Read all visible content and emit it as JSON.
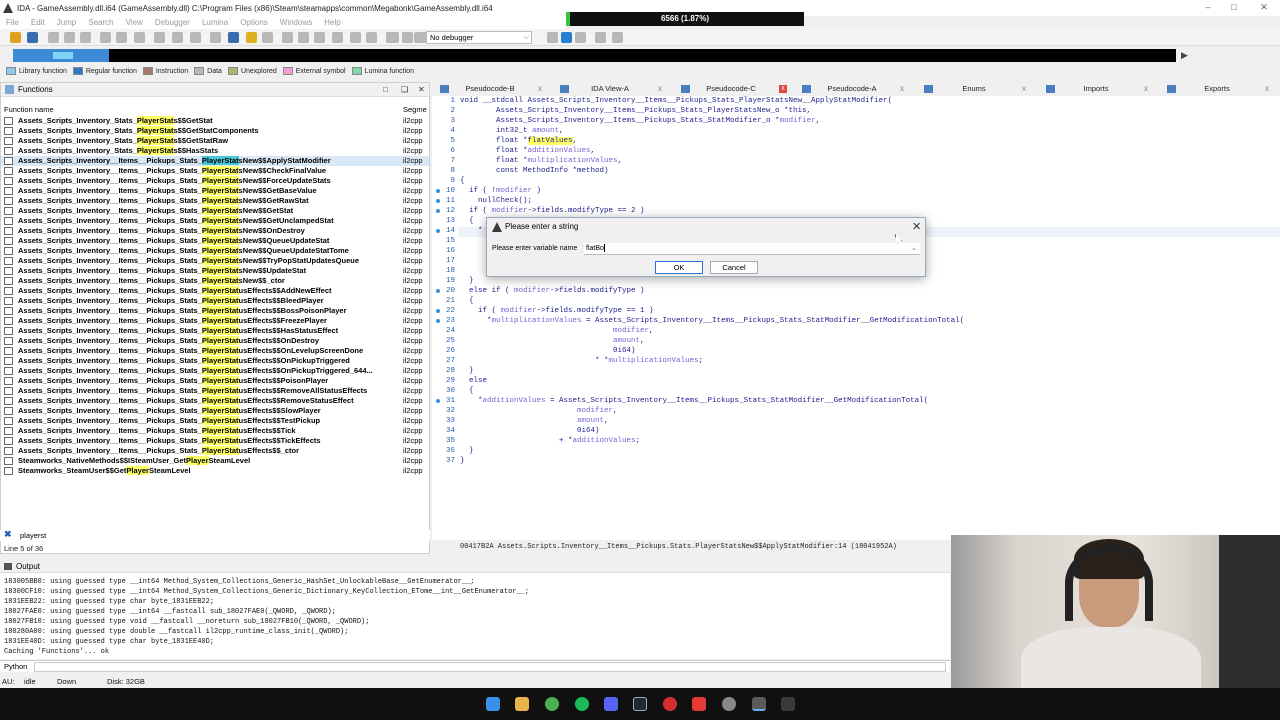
{
  "window": {
    "title": "IDA - GameAssembly.dll.i64 (GameAssembly.dll) C:\\Program Files (x86)\\Steam\\steamapps\\common\\Megabonk\\GameAssembly.dll.i64",
    "progress_label": "6566 (1.87%)",
    "progress_fraction": 0.0187
  },
  "menu": [
    "File",
    "Edit",
    "Jump",
    "Search",
    "View",
    "Debugger",
    "Lumina",
    "Options",
    "Windows",
    "Help"
  ],
  "toolbar": {
    "debugger_select": "No debugger"
  },
  "legend": [
    {
      "label": "Library function",
      "color": "#8ec8ec"
    },
    {
      "label": "Regular function",
      "color": "#2f76c5"
    },
    {
      "label": "Instruction",
      "color": "#a5786a"
    },
    {
      "label": "Data",
      "color": "#b8b8b8"
    },
    {
      "label": "Unexplored",
      "color": "#a8b86c"
    },
    {
      "label": "External symbol",
      "color": "#f59bd8"
    },
    {
      "label": "Lumina function",
      "color": "#7fd6a8"
    }
  ],
  "functions_panel": {
    "title": "Functions",
    "col_name": "Function name",
    "col_segment": "Segme",
    "rows": [
      {
        "pre": "Assets_Scripts_Inventory_Stats_",
        "hl": "PlayerStat",
        "post": "s$$GetStat",
        "seg": "il2cpp"
      },
      {
        "pre": "Assets_Scripts_Inventory_Stats_",
        "hl": "PlayerStat",
        "post": "s$$GetStatComponents",
        "seg": "il2cpp"
      },
      {
        "pre": "Assets_Scripts_Inventory_Stats_",
        "hl": "PlayerStat",
        "post": "s$$GetStatRaw",
        "seg": "il2cpp"
      },
      {
        "pre": "Assets_Scripts_Inventory_Stats_",
        "hl": "PlayerStat",
        "post": "s$$HasStats",
        "seg": "il2cpp"
      },
      {
        "pre": "Assets_Scripts_Inventory__Items__Pickups_Stats_",
        "hl": "PlayerStat",
        "post": "sNew$$ApplyStatModifier",
        "seg": "il2cpp"
      },
      {
        "pre": "Assets_Scripts_Inventory__Items__Pickups_Stats_",
        "hl": "PlayerStat",
        "post": "sNew$$CheckFinalValue",
        "seg": "il2cpp"
      },
      {
        "pre": "Assets_Scripts_Inventory__Items__Pickups_Stats_",
        "hl": "PlayerStat",
        "post": "sNew$$ForceUpdateStats",
        "seg": "il2cpp"
      },
      {
        "pre": "Assets_Scripts_Inventory__Items__Pickups_Stats_",
        "hl": "PlayerStat",
        "post": "sNew$$GetBaseValue",
        "seg": "il2cpp"
      },
      {
        "pre": "Assets_Scripts_Inventory__Items__Pickups_Stats_",
        "hl": "PlayerStat",
        "post": "sNew$$GetRawStat",
        "seg": "il2cpp"
      },
      {
        "pre": "Assets_Scripts_Inventory__Items__Pickups_Stats_",
        "hl": "PlayerStat",
        "post": "sNew$$GetStat",
        "seg": "il2cpp"
      },
      {
        "pre": "Assets_Scripts_Inventory__Items__Pickups_Stats_",
        "hl": "PlayerStat",
        "post": "sNew$$GetUnclampedStat",
        "seg": "il2cpp"
      },
      {
        "pre": "Assets_Scripts_Inventory__Items__Pickups_Stats_",
        "hl": "PlayerStat",
        "post": "sNew$$OnDestroy",
        "seg": "il2cpp"
      },
      {
        "pre": "Assets_Scripts_Inventory__Items__Pickups_Stats_",
        "hl": "PlayerStat",
        "post": "sNew$$QueueUpdateStat",
        "seg": "il2cpp"
      },
      {
        "pre": "Assets_Scripts_Inventory__Items__Pickups_Stats_",
        "hl": "PlayerStat",
        "post": "sNew$$QueueUpdateStatTome",
        "seg": "il2cpp"
      },
      {
        "pre": "Assets_Scripts_Inventory__Items__Pickups_Stats_",
        "hl": "PlayerStat",
        "post": "sNew$$TryPopStatUpdatesQueue",
        "seg": "il2cpp"
      },
      {
        "pre": "Assets_Scripts_Inventory__Items__Pickups_Stats_",
        "hl": "PlayerStat",
        "post": "sNew$$UpdateStat",
        "seg": "il2cpp"
      },
      {
        "pre": "Assets_Scripts_Inventory__Items__Pickups_Stats_",
        "hl": "PlayerStat",
        "post": "sNew$$_ctor",
        "seg": "il2cpp"
      },
      {
        "pre": "Assets_Scripts_Inventory__Items__Pickups_Stats_",
        "hl": "PlayerStat",
        "post": "usEffects$$AddNewEffect",
        "seg": "il2cpp"
      },
      {
        "pre": "Assets_Scripts_Inventory__Items__Pickups_Stats_",
        "hl": "PlayerStat",
        "post": "usEffects$$BleedPlayer",
        "seg": "il2cpp"
      },
      {
        "pre": "Assets_Scripts_Inventory__Items__Pickups_Stats_",
        "hl": "PlayerStat",
        "post": "usEffects$$BossPoisonPlayer",
        "seg": "il2cpp"
      },
      {
        "pre": "Assets_Scripts_Inventory__Items__Pickups_Stats_",
        "hl": "PlayerStat",
        "post": "usEffects$$FreezePlayer",
        "seg": "il2cpp"
      },
      {
        "pre": "Assets_Scripts_Inventory__Items__Pickups_Stats_",
        "hl": "PlayerStat",
        "post": "usEffects$$HasStatusEffect",
        "seg": "il2cpp"
      },
      {
        "pre": "Assets_Scripts_Inventory__Items__Pickups_Stats_",
        "hl": "PlayerStat",
        "post": "usEffects$$OnDestroy",
        "seg": "il2cpp"
      },
      {
        "pre": "Assets_Scripts_Inventory__Items__Pickups_Stats_",
        "hl": "PlayerStat",
        "post": "usEffects$$OnLevelupScreenDone",
        "seg": "il2cpp"
      },
      {
        "pre": "Assets_Scripts_Inventory__Items__Pickups_Stats_",
        "hl": "PlayerStat",
        "post": "usEffects$$OnPickupTriggered",
        "seg": "il2cpp"
      },
      {
        "pre": "Assets_Scripts_Inventory__Items__Pickups_Stats_",
        "hl": "PlayerStat",
        "post": "usEffects$$OnPickupTriggered_644...",
        "seg": "il2cpp"
      },
      {
        "pre": "Assets_Scripts_Inventory__Items__Pickups_Stats_",
        "hl": "PlayerStat",
        "post": "usEffects$$PoisonPlayer",
        "seg": "il2cpp"
      },
      {
        "pre": "Assets_Scripts_Inventory__Items__Pickups_Stats_",
        "hl": "PlayerStat",
        "post": "usEffects$$RemoveAllStatusEffects",
        "seg": "il2cpp"
      },
      {
        "pre": "Assets_Scripts_Inventory__Items__Pickups_Stats_",
        "hl": "PlayerStat",
        "post": "usEffects$$RemoveStatusEffect",
        "seg": "il2cpp"
      },
      {
        "pre": "Assets_Scripts_Inventory__Items__Pickups_Stats_",
        "hl": "PlayerStat",
        "post": "usEffects$$SlowPlayer",
        "seg": "il2cpp"
      },
      {
        "pre": "Assets_Scripts_Inventory__Items__Pickups_Stats_",
        "hl": "PlayerStat",
        "post": "usEffects$$TestPickup",
        "seg": "il2cpp"
      },
      {
        "pre": "Assets_Scripts_Inventory__Items__Pickups_Stats_",
        "hl": "PlayerStat",
        "post": "usEffects$$Tick",
        "seg": "il2cpp"
      },
      {
        "pre": "Assets_Scripts_Inventory__Items__Pickups_Stats_",
        "hl": "PlayerStat",
        "post": "usEffects$$TickEffects",
        "seg": "il2cpp"
      },
      {
        "pre": "Assets_Scripts_Inventory__Items__Pickups_Stats_",
        "hl": "PlayerStat",
        "post": "usEffects$$_ctor",
        "seg": "il2cpp"
      },
      {
        "pre": "Steamworks_NativeMethods$$ISteamUser_Get",
        "hl": "Player",
        "post": "SteamLevel",
        "seg": "il2cpp"
      },
      {
        "pre": "Steamworks_SteamUser$$Get",
        "hl": "Player",
        "post": "SteamLevel",
        "seg": "il2cpp"
      }
    ],
    "selected_index": 4,
    "search_query": "playerst",
    "line_status": "Line 5 of 36"
  },
  "tabs": [
    {
      "label": "Pseudocode-B",
      "close": "x"
    },
    {
      "label": "IDA View-A",
      "close": "x"
    },
    {
      "label": "Pseudocode-C",
      "close": "x",
      "active": true
    },
    {
      "label": "Pseudocode-A",
      "close": "x"
    },
    {
      "label": "Enums",
      "close": "x"
    },
    {
      "label": "Imports",
      "close": "x"
    },
    {
      "label": "Exports",
      "close": "x"
    }
  ],
  "code": {
    "lines": [
      {
        "n": "1",
        "t": "void __stdcall Assets_Scripts_Inventory__Items__Pickups_Stats_PlayerStatsNew__ApplyStatModifier("
      },
      {
        "n": "2",
        "t": "        Assets_Scripts_Inventory__Items__Pickups_Stats_PlayerStatsNew_o *this,"
      },
      {
        "n": "3",
        "t": "        Assets_Scripts_Inventory__Items__Pickups_Stats_StatModifier_o *modifier,"
      },
      {
        "n": "4",
        "t": "        int32_t amount,"
      },
      {
        "n": "5",
        "t": "        float *flatValues,"
      },
      {
        "n": "6",
        "t": "        float *additionValues,"
      },
      {
        "n": "7",
        "t": "        float *multiplicationValues,"
      },
      {
        "n": "8",
        "t": "        const MethodInfo *method)"
      },
      {
        "n": "9",
        "t": "{"
      },
      {
        "n": "10",
        "t": "  if ( !modifier )"
      },
      {
        "n": "11",
        "t": "    nullCheck();"
      },
      {
        "n": "12",
        "t": "  if ( modifier->fields.modifyType == 2 )"
      },
      {
        "n": "13",
        "t": "  {"
      },
      {
        "n": "14",
        "t": "    *"
      },
      {
        "n": "15",
        "t": ""
      },
      {
        "n": "16",
        "t": ""
      },
      {
        "n": "17",
        "t": ""
      },
      {
        "n": "18",
        "t": ""
      },
      {
        "n": "19",
        "t": "  }"
      },
      {
        "n": "20",
        "t": "  else if ( modifier->fields.modifyType )"
      },
      {
        "n": "21",
        "t": "  {"
      },
      {
        "n": "22",
        "t": "    if ( modifier->fields.modifyType == 1 )"
      },
      {
        "n": "23",
        "t": "      *multiplicationValues = Assets_Scripts_Inventory__Items__Pickups_Stats_StatModifier__GetModificationTotal("
      },
      {
        "n": "24",
        "t": "                                  modifier,"
      },
      {
        "n": "25",
        "t": "                                  amount,"
      },
      {
        "n": "26",
        "t": "                                  0i64)"
      },
      {
        "n": "27",
        "t": "                              * *multiplicationValues;"
      },
      {
        "n": "28",
        "t": "  }"
      },
      {
        "n": "29",
        "t": "  else"
      },
      {
        "n": "30",
        "t": "  {"
      },
      {
        "n": "31",
        "t": "    *additionValues = Assets_Scripts_Inventory__Items__Pickups_Stats_StatModifier__GetModificationTotal("
      },
      {
        "n": "32",
        "t": "                          modifier,"
      },
      {
        "n": "33",
        "t": "                          amount,"
      },
      {
        "n": "34",
        "t": "                          0i64)"
      },
      {
        "n": "35",
        "t": "                      + *additionValues;"
      },
      {
        "n": "36",
        "t": "  }"
      },
      {
        "n": "37",
        "t": "}"
      }
    ],
    "dotted_lines": [
      "10",
      "11",
      "12",
      "14",
      "20",
      "22",
      "23",
      "31"
    ],
    "address_bar": "00417B2A Assets.Scripts.Inventory__Items__Pickups.Stats.PlayerStatsNew$$ApplyStatModifier:14 (18041952A)"
  },
  "dialog": {
    "title": "Please enter a string",
    "label": "Please enter variable name",
    "value": "flatBo",
    "ok": "OK",
    "cancel": "Cancel"
  },
  "output": {
    "title": "Output",
    "lines": [
      "183005BB0: using guessed type __int64 Method_System_Collections_Generic_HashSet_UnlockableBase__GetEnumerator__;",
      "18300CF10: using guessed type __int64 Method_System_Collections_Generic_Dictionary_KeyCollection_ETome__int__GetEnumerator__;",
      "1831EEB22: using guessed type char byte_1831EEB22;",
      "18027FAE0: using guessed type __int64 __fastcall sub_18027FAE0(_QWORD, _QWORD);",
      "18027FB10: using guessed type void __fastcall __noreturn sub_18027FB10(_QWORD, _QWORD);",
      "180280A00: using guessed type double __fastcall il2cpp_runtime_class_init(_QWORD);",
      "1831EE40D: using guessed type char byte_1831EE40D;",
      "Caching 'Functions'... ok"
    ],
    "python_label": "Python"
  },
  "status": {
    "au": "AU:",
    "state": "idle",
    "dir": "Down",
    "disk": "Disk: 32GB"
  }
}
